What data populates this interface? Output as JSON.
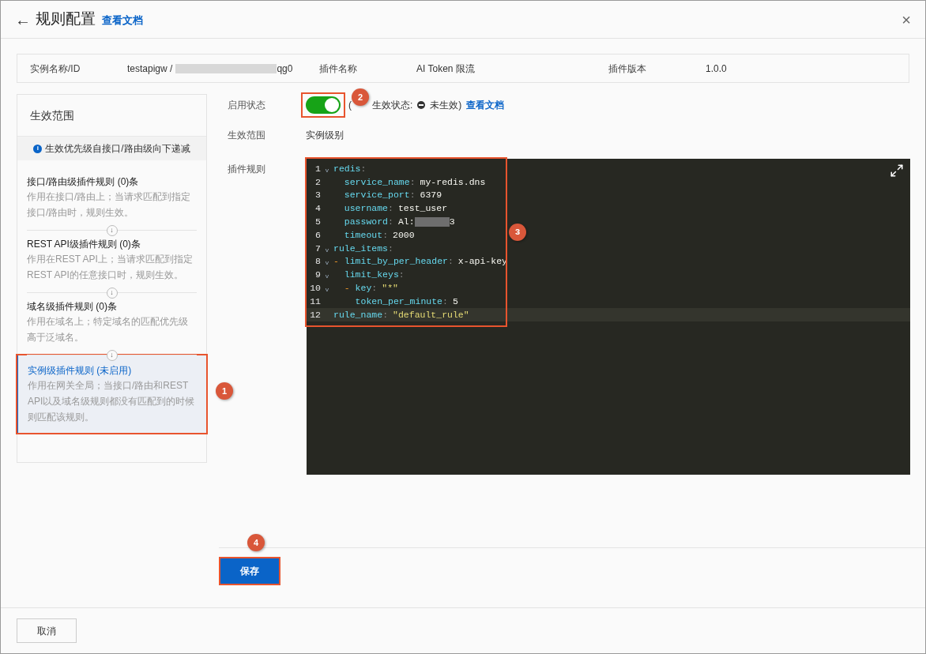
{
  "header": {
    "back": "←",
    "title": "规则配置",
    "doc_link": "查看文档",
    "close": "×"
  },
  "info": [
    {
      "label": "实例名称/ID",
      "value": "testapigw /",
      "redacted": true,
      "value_end": "qg0"
    },
    {
      "label": "插件名称",
      "value": "AI Token 限流"
    },
    {
      "label": "插件版本",
      "value": "1.0.0"
    }
  ],
  "sidebar": {
    "title": "生效范围",
    "notice_icon": "i",
    "notice": "生效优先级自接口/路由级向下递减",
    "items": [
      {
        "title": "接口/路由级插件规则 (0)条",
        "desc": "作用在接口/路由上；当请求匹配到指定接口/路由时，规则生效。",
        "selected": false
      },
      {
        "arrow": "↓",
        "title": "REST API级插件规则 (0)条",
        "desc": "作用在REST API上；当请求匹配到指定REST API的任意接口时，规则生效。",
        "selected": false
      },
      {
        "arrow": "↓",
        "title": "域名级插件规则 (0)条",
        "desc": "作用在域名上；特定域名的匹配优先级高于泛域名。",
        "selected": false
      },
      {
        "arrow": "↓",
        "title": "实例级插件规则 (未启用)",
        "desc": "作用在网关全局；当接口/路由和REST API以及域名级规则都没有匹配到的时候则匹配该规则。",
        "selected": true,
        "callout": "1"
      }
    ]
  },
  "form": {
    "enable_label": "启用状态",
    "enabled": true,
    "callout": "2",
    "status_open": "(",
    "status_label": "生效状态:",
    "status_value": "未生效)",
    "status_doc": "查看文档",
    "scope_label": "生效范围",
    "scope_value": "实例级别",
    "rules_label": "插件规则"
  },
  "editor": {
    "callout": "3",
    "lines": [
      {
        "n": "1",
        "fold": "v",
        "key": "redis",
        "colon": ":",
        "current": false
      },
      {
        "n": "2",
        "key": "  service_name",
        "colon": ":",
        "value": "my-redis.dns",
        "kind": "plain",
        "current": false
      },
      {
        "n": "3",
        "key": "  service_port",
        "colon": ":",
        "value": "6379",
        "kind": "plain",
        "current": false
      },
      {
        "n": "4",
        "key": "  username",
        "colon": ":",
        "value": "test_user",
        "kind": "plain",
        "current": false
      },
      {
        "n": "5",
        "key": "  password",
        "colon": ":",
        "value": "Al:",
        "redacted": true,
        "value_end": "3",
        "kind": "plain",
        "current": false
      },
      {
        "n": "6",
        "key": "  timeout",
        "colon": ":",
        "value": "2000",
        "kind": "plain",
        "current": false
      },
      {
        "n": "7",
        "fold": "v",
        "key": "rule_items",
        "colon": ":",
        "current": false
      },
      {
        "n": "8",
        "fold": "v",
        "dash": "-",
        "key": "limit_by_per_header",
        "colon": ":",
        "value": "x-api-key",
        "kind": "plain",
        "current": false
      },
      {
        "n": "9",
        "fold": "v",
        "key": "  limit_keys",
        "colon": ":",
        "current": false
      },
      {
        "n": "10",
        "fold": "v",
        "dash": "  -",
        "key": "key",
        "colon": ":",
        "value": "\"*\"",
        "kind": "string",
        "current": false
      },
      {
        "n": "11",
        "key": "    token_per_minute",
        "colon": ":",
        "value": "5",
        "kind": "plain",
        "current": false
      },
      {
        "n": "12",
        "key": "rule_name",
        "colon": ":",
        "value": "\"default_rule\"",
        "kind": "string",
        "current": true
      }
    ]
  },
  "save_button": {
    "label": "保存",
    "callout": "4"
  },
  "cancel_button": "取消"
}
